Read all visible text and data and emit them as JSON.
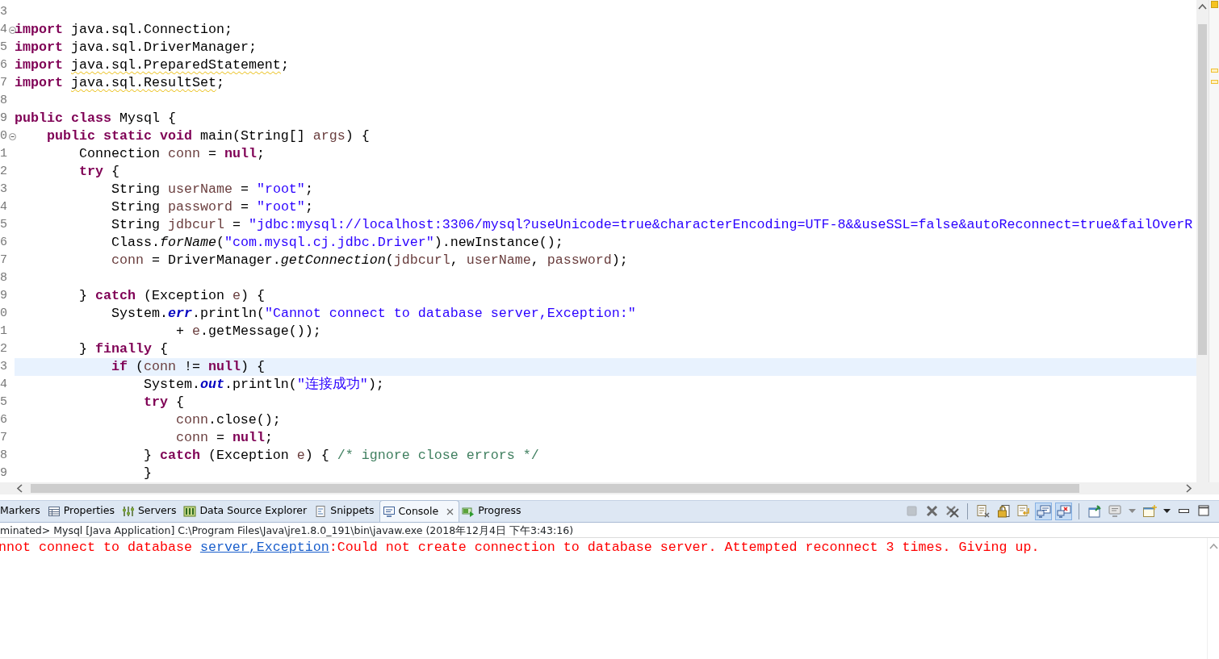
{
  "editor": {
    "lines": [
      {
        "number": "3"
      },
      {
        "number": "4",
        "fold": true,
        "tokens": [
          {
            "kind": "keyword",
            "text": "import"
          },
          {
            "kind": "plain",
            "text": " java.sql.Connection;"
          }
        ]
      },
      {
        "number": "5",
        "tokens": [
          {
            "kind": "keyword",
            "text": "import"
          },
          {
            "kind": "plain",
            "text": " java.sql.DriverManager;"
          }
        ]
      },
      {
        "number": "6",
        "tokens": [
          {
            "kind": "keyword",
            "text": "import"
          },
          {
            "kind": "plain",
            "text": " java.sql.PreparedStatement",
            "warning": true
          },
          {
            "kind": "plain",
            "text": ";"
          }
        ]
      },
      {
        "number": "7",
        "tokens": [
          {
            "kind": "keyword",
            "text": "import"
          },
          {
            "kind": "plain",
            "text": " java.sql.ResultSet",
            "warning": true
          },
          {
            "kind": "plain",
            "text": ";"
          }
        ]
      },
      {
        "number": "8"
      },
      {
        "number": "9",
        "tokens": [
          {
            "kind": "keyword",
            "text": "public class"
          },
          {
            "kind": "plain",
            "text": " Mysql {"
          }
        ]
      },
      {
        "number": "0",
        "fold": true,
        "tokens": [
          {
            "kind": "keyword",
            "text": "    public static void"
          },
          {
            "kind": "plain",
            "text": " main(String[] "
          },
          {
            "kind": "variable",
            "text": "args"
          },
          {
            "kind": "plain",
            "text": ") {"
          }
        ]
      },
      {
        "number": "1",
        "tokens": [
          {
            "kind": "plain",
            "text": "        Connection "
          },
          {
            "kind": "variable",
            "text": "conn"
          },
          {
            "kind": "plain",
            "text": " = "
          },
          {
            "kind": "keyword",
            "text": "null"
          },
          {
            "kind": "plain",
            "text": ";"
          }
        ]
      },
      {
        "number": "2",
        "tokens": [
          {
            "kind": "keyword",
            "text": "        try"
          },
          {
            "kind": "plain",
            "text": " {"
          }
        ]
      },
      {
        "number": "3",
        "tokens": [
          {
            "kind": "plain",
            "text": "            String "
          },
          {
            "kind": "variable",
            "text": "userName"
          },
          {
            "kind": "plain",
            "text": " = "
          },
          {
            "kind": "string",
            "text": "\"root\""
          },
          {
            "kind": "plain",
            "text": ";"
          }
        ]
      },
      {
        "number": "4",
        "tokens": [
          {
            "kind": "plain",
            "text": "            String "
          },
          {
            "kind": "variable",
            "text": "password"
          },
          {
            "kind": "plain",
            "text": " = "
          },
          {
            "kind": "string",
            "text": "\"root\""
          },
          {
            "kind": "plain",
            "text": ";"
          }
        ]
      },
      {
        "number": "5",
        "tokens": [
          {
            "kind": "plain",
            "text": "            String "
          },
          {
            "kind": "variable",
            "text": "jdbcurl"
          },
          {
            "kind": "plain",
            "text": " = "
          },
          {
            "kind": "string",
            "text": "\"jdbc:mysql://localhost:3306/mysql?useUnicode=true&characterEncoding=UTF-8&&useSSL=false&autoReconnect=true&failOverR"
          }
        ]
      },
      {
        "number": "6",
        "tokens": [
          {
            "kind": "plain",
            "text": "            Class."
          },
          {
            "kind": "static_method",
            "text": "forName"
          },
          {
            "kind": "plain",
            "text": "("
          },
          {
            "kind": "string",
            "text": "\"com.mysql.cj.jdbc.Driver\""
          },
          {
            "kind": "plain",
            "text": ").newInstance();"
          }
        ]
      },
      {
        "number": "7",
        "tokens": [
          {
            "kind": "variable",
            "text": "            conn"
          },
          {
            "kind": "plain",
            "text": " = DriverManager."
          },
          {
            "kind": "static_method",
            "text": "getConnection"
          },
          {
            "kind": "plain",
            "text": "("
          },
          {
            "kind": "variable",
            "text": "jdbcurl"
          },
          {
            "kind": "plain",
            "text": ", "
          },
          {
            "kind": "variable",
            "text": "userName"
          },
          {
            "kind": "plain",
            "text": ", "
          },
          {
            "kind": "variable",
            "text": "password"
          },
          {
            "kind": "plain",
            "text": ");"
          }
        ]
      },
      {
        "number": "8"
      },
      {
        "number": "9",
        "tokens": [
          {
            "kind": "plain",
            "text": "        } "
          },
          {
            "kind": "keyword",
            "text": "catch"
          },
          {
            "kind": "plain",
            "text": " (Exception "
          },
          {
            "kind": "variable",
            "text": "e"
          },
          {
            "kind": "plain",
            "text": ") {"
          }
        ]
      },
      {
        "number": "0",
        "tokens": [
          {
            "kind": "plain",
            "text": "            System."
          },
          {
            "kind": "static_field",
            "text": "err"
          },
          {
            "kind": "plain",
            "text": ".println("
          },
          {
            "kind": "string",
            "text": "\"Cannot connect to database server,Exception:\""
          }
        ]
      },
      {
        "number": "1",
        "tokens": [
          {
            "kind": "plain",
            "text": "                    + "
          },
          {
            "kind": "variable",
            "text": "e"
          },
          {
            "kind": "plain",
            "text": ".getMessage());"
          }
        ]
      },
      {
        "number": "2",
        "tokens": [
          {
            "kind": "plain",
            "text": "        } "
          },
          {
            "kind": "keyword",
            "text": "finally"
          },
          {
            "kind": "plain",
            "text": " {"
          }
        ]
      },
      {
        "number": "3",
        "current": true,
        "tokens": [
          {
            "kind": "keyword",
            "text": "            if"
          },
          {
            "kind": "plain",
            "text": " ("
          },
          {
            "kind": "variable",
            "text": "conn"
          },
          {
            "kind": "plain",
            "text": " != "
          },
          {
            "kind": "keyword",
            "text": "null"
          },
          {
            "kind": "plain",
            "text": ") {"
          }
        ]
      },
      {
        "number": "4",
        "tokens": [
          {
            "kind": "plain",
            "text": "                System."
          },
          {
            "kind": "static_field",
            "text": "out"
          },
          {
            "kind": "plain",
            "text": ".println("
          },
          {
            "kind": "string",
            "text": "\"连接成功\""
          },
          {
            "kind": "plain",
            "text": ");"
          }
        ]
      },
      {
        "number": "5",
        "tokens": [
          {
            "kind": "keyword",
            "text": "                try"
          },
          {
            "kind": "plain",
            "text": " {"
          }
        ]
      },
      {
        "number": "6",
        "tokens": [
          {
            "kind": "variable",
            "text": "                    conn"
          },
          {
            "kind": "plain",
            "text": ".close();"
          }
        ]
      },
      {
        "number": "7",
        "tokens": [
          {
            "kind": "variable",
            "text": "                    conn"
          },
          {
            "kind": "plain",
            "text": " = "
          },
          {
            "kind": "keyword",
            "text": "null"
          },
          {
            "kind": "plain",
            "text": ";"
          }
        ]
      },
      {
        "number": "8",
        "tokens": [
          {
            "kind": "plain",
            "text": "                } "
          },
          {
            "kind": "keyword",
            "text": "catch"
          },
          {
            "kind": "plain",
            "text": " (Exception "
          },
          {
            "kind": "variable",
            "text": "e"
          },
          {
            "kind": "plain",
            "text": ") { "
          },
          {
            "kind": "comment",
            "text": "/* ignore close errors */"
          }
        ]
      },
      {
        "number": "9",
        "tokens": [
          {
            "kind": "plain",
            "text": "                }"
          }
        ]
      }
    ]
  },
  "panel": {
    "tabs": [
      {
        "label": "Markers",
        "selected": false
      },
      {
        "label": "Properties",
        "selected": false
      },
      {
        "label": "Servers",
        "selected": false
      },
      {
        "label": "Data Source Explorer",
        "selected": false
      },
      {
        "label": "Snippets",
        "selected": false
      },
      {
        "label": "Console",
        "selected": true
      },
      {
        "label": "Progress",
        "selected": false
      }
    ],
    "toolbar": [
      {
        "kind": "stop",
        "disabled": true,
        "pressed": false
      },
      {
        "kind": "remove",
        "disabled": false,
        "pressed": false
      },
      {
        "kind": "remove_all",
        "disabled": false,
        "pressed": false
      },
      {
        "kind": "separator"
      },
      {
        "kind": "clear",
        "disabled": false,
        "pressed": false
      },
      {
        "kind": "lock",
        "disabled": false,
        "pressed": false
      },
      {
        "kind": "wrap",
        "disabled": false,
        "pressed": false
      },
      {
        "kind": "stdout",
        "disabled": false,
        "pressed": true
      },
      {
        "kind": "stderr",
        "disabled": false,
        "pressed": true
      },
      {
        "kind": "separator"
      },
      {
        "kind": "pin",
        "disabled": false,
        "pressed": false
      },
      {
        "kind": "display",
        "disabled": false,
        "pressed": false
      },
      {
        "kind": "dropdown",
        "disabled": false,
        "pressed": false
      },
      {
        "kind": "new_console",
        "disabled": false,
        "pressed": false
      },
      {
        "kind": "dropdown_dark",
        "disabled": false,
        "pressed": false
      },
      {
        "kind": "minimize",
        "disabled": false,
        "pressed": false
      },
      {
        "kind": "maximize",
        "disabled": false,
        "pressed": false
      }
    ],
    "status": "minated> Mysql [Java Application] C:\\Program Files\\Java\\jre1.8.0_191\\bin\\javaw.exe (2018年12月4日 下午3:43:16)",
    "output": [
      {
        "kind": "error",
        "text": "nnot connect to database "
      },
      {
        "kind": "link",
        "text": "server,Exception"
      },
      {
        "kind": "error",
        "text": ":Could not create connection to database server. Attempted reconnect 3 times. Giving up."
      }
    ]
  }
}
